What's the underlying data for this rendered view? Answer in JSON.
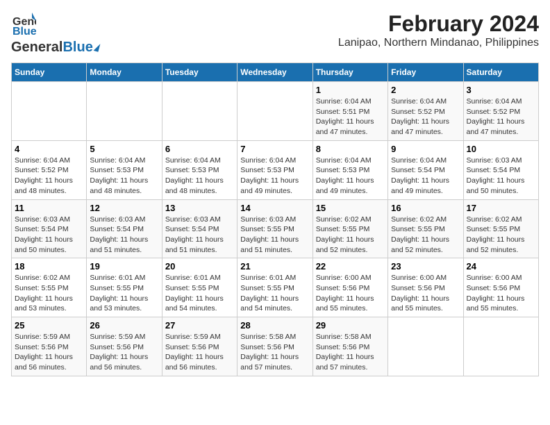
{
  "logo": {
    "line1": "General",
    "line2": "Blue"
  },
  "title": "February 2024",
  "subtitle": "Lanipao, Northern Mindanao, Philippines",
  "weekdays": [
    "Sunday",
    "Monday",
    "Tuesday",
    "Wednesday",
    "Thursday",
    "Friday",
    "Saturday"
  ],
  "weeks": [
    [
      {
        "day": "",
        "info": ""
      },
      {
        "day": "",
        "info": ""
      },
      {
        "day": "",
        "info": ""
      },
      {
        "day": "",
        "info": ""
      },
      {
        "day": "1",
        "info": "Sunrise: 6:04 AM\nSunset: 5:51 PM\nDaylight: 11 hours and 47 minutes."
      },
      {
        "day": "2",
        "info": "Sunrise: 6:04 AM\nSunset: 5:52 PM\nDaylight: 11 hours and 47 minutes."
      },
      {
        "day": "3",
        "info": "Sunrise: 6:04 AM\nSunset: 5:52 PM\nDaylight: 11 hours and 47 minutes."
      }
    ],
    [
      {
        "day": "4",
        "info": "Sunrise: 6:04 AM\nSunset: 5:52 PM\nDaylight: 11 hours and 48 minutes."
      },
      {
        "day": "5",
        "info": "Sunrise: 6:04 AM\nSunset: 5:53 PM\nDaylight: 11 hours and 48 minutes."
      },
      {
        "day": "6",
        "info": "Sunrise: 6:04 AM\nSunset: 5:53 PM\nDaylight: 11 hours and 48 minutes."
      },
      {
        "day": "7",
        "info": "Sunrise: 6:04 AM\nSunset: 5:53 PM\nDaylight: 11 hours and 49 minutes."
      },
      {
        "day": "8",
        "info": "Sunrise: 6:04 AM\nSunset: 5:53 PM\nDaylight: 11 hours and 49 minutes."
      },
      {
        "day": "9",
        "info": "Sunrise: 6:04 AM\nSunset: 5:54 PM\nDaylight: 11 hours and 49 minutes."
      },
      {
        "day": "10",
        "info": "Sunrise: 6:03 AM\nSunset: 5:54 PM\nDaylight: 11 hours and 50 minutes."
      }
    ],
    [
      {
        "day": "11",
        "info": "Sunrise: 6:03 AM\nSunset: 5:54 PM\nDaylight: 11 hours and 50 minutes."
      },
      {
        "day": "12",
        "info": "Sunrise: 6:03 AM\nSunset: 5:54 PM\nDaylight: 11 hours and 51 minutes."
      },
      {
        "day": "13",
        "info": "Sunrise: 6:03 AM\nSunset: 5:54 PM\nDaylight: 11 hours and 51 minutes."
      },
      {
        "day": "14",
        "info": "Sunrise: 6:03 AM\nSunset: 5:55 PM\nDaylight: 11 hours and 51 minutes."
      },
      {
        "day": "15",
        "info": "Sunrise: 6:02 AM\nSunset: 5:55 PM\nDaylight: 11 hours and 52 minutes."
      },
      {
        "day": "16",
        "info": "Sunrise: 6:02 AM\nSunset: 5:55 PM\nDaylight: 11 hours and 52 minutes."
      },
      {
        "day": "17",
        "info": "Sunrise: 6:02 AM\nSunset: 5:55 PM\nDaylight: 11 hours and 52 minutes."
      }
    ],
    [
      {
        "day": "18",
        "info": "Sunrise: 6:02 AM\nSunset: 5:55 PM\nDaylight: 11 hours and 53 minutes."
      },
      {
        "day": "19",
        "info": "Sunrise: 6:01 AM\nSunset: 5:55 PM\nDaylight: 11 hours and 53 minutes."
      },
      {
        "day": "20",
        "info": "Sunrise: 6:01 AM\nSunset: 5:55 PM\nDaylight: 11 hours and 54 minutes."
      },
      {
        "day": "21",
        "info": "Sunrise: 6:01 AM\nSunset: 5:55 PM\nDaylight: 11 hours and 54 minutes."
      },
      {
        "day": "22",
        "info": "Sunrise: 6:00 AM\nSunset: 5:56 PM\nDaylight: 11 hours and 55 minutes."
      },
      {
        "day": "23",
        "info": "Sunrise: 6:00 AM\nSunset: 5:56 PM\nDaylight: 11 hours and 55 minutes."
      },
      {
        "day": "24",
        "info": "Sunrise: 6:00 AM\nSunset: 5:56 PM\nDaylight: 11 hours and 55 minutes."
      }
    ],
    [
      {
        "day": "25",
        "info": "Sunrise: 5:59 AM\nSunset: 5:56 PM\nDaylight: 11 hours and 56 minutes."
      },
      {
        "day": "26",
        "info": "Sunrise: 5:59 AM\nSunset: 5:56 PM\nDaylight: 11 hours and 56 minutes."
      },
      {
        "day": "27",
        "info": "Sunrise: 5:59 AM\nSunset: 5:56 PM\nDaylight: 11 hours and 56 minutes."
      },
      {
        "day": "28",
        "info": "Sunrise: 5:58 AM\nSunset: 5:56 PM\nDaylight: 11 hours and 57 minutes."
      },
      {
        "day": "29",
        "info": "Sunrise: 5:58 AM\nSunset: 5:56 PM\nDaylight: 11 hours and 57 minutes."
      },
      {
        "day": "",
        "info": ""
      },
      {
        "day": "",
        "info": ""
      }
    ]
  ]
}
